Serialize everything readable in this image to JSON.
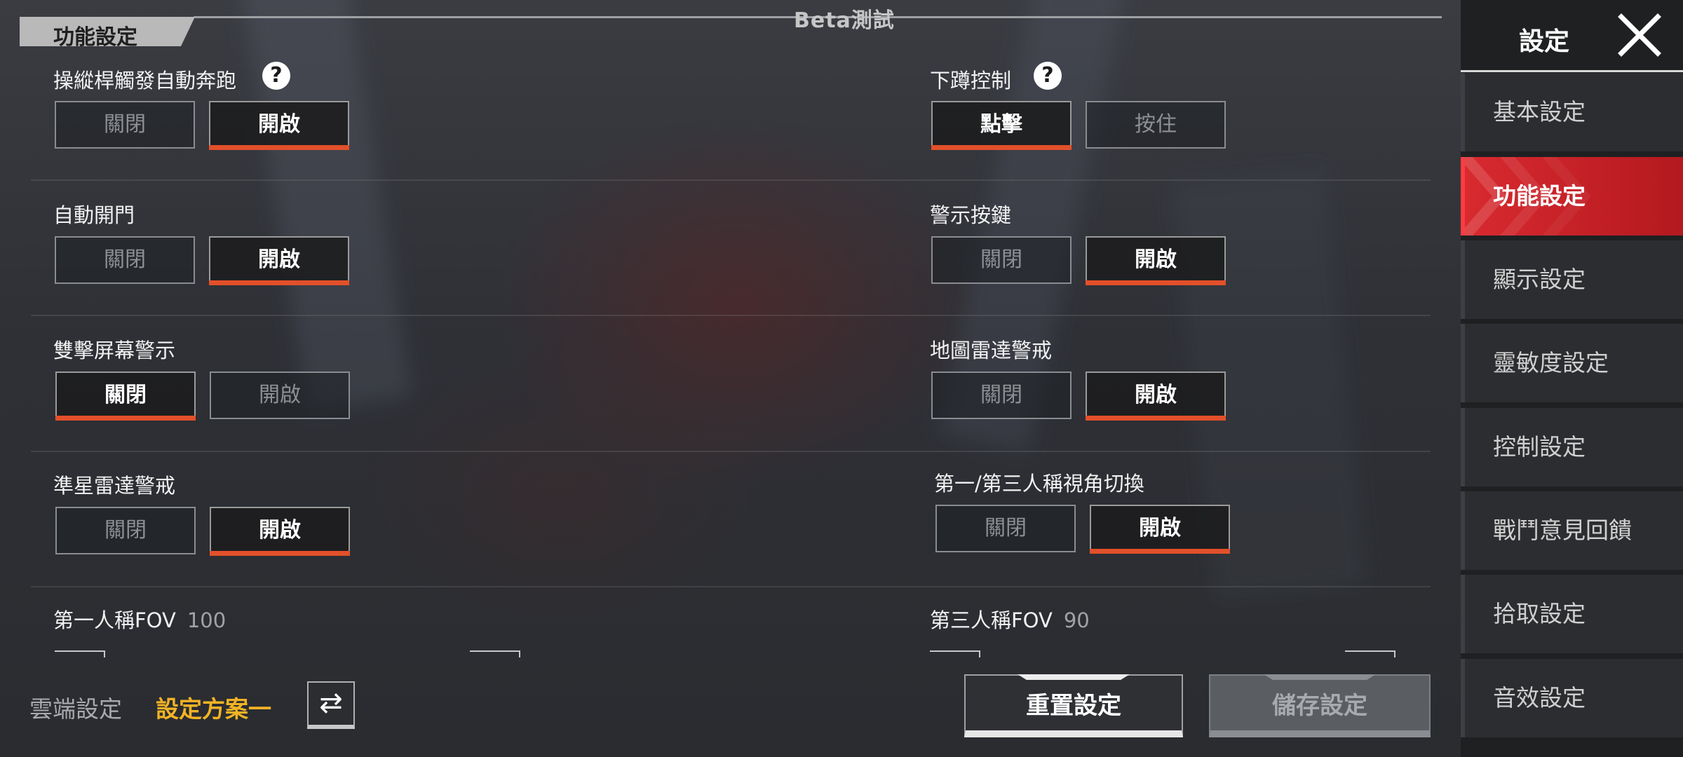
{
  "header": {
    "title": "功能設定",
    "beta_label": "Beta測試"
  },
  "settings": {
    "joystick_autorun": {
      "label": "操縱桿觸發自動奔跑",
      "options": [
        "關閉",
        "開啟"
      ],
      "selected": "開啟",
      "help_icon": "question-circle-icon"
    },
    "crouch_control": {
      "label": "下蹲控制",
      "options": [
        "點擊",
        "按住"
      ],
      "selected": "點擊",
      "help_icon": "question-circle-icon"
    },
    "auto_door": {
      "label": "自動開門",
      "options": [
        "關閉",
        "開啟"
      ],
      "selected": "開啟"
    },
    "alert_button": {
      "label": "警示按鍵",
      "options": [
        "關閉",
        "開啟"
      ],
      "selected": "開啟"
    },
    "double_tap_alert": {
      "label": "雙擊屏幕警示",
      "options": [
        "關閉",
        "開啟"
      ],
      "selected": "關閉"
    },
    "map_radar_alert": {
      "label": "地圖雷達警戒",
      "options": [
        "關閉",
        "開啟"
      ],
      "selected": "開啟"
    },
    "crosshair_radar_alert": {
      "label": "準星雷達警戒",
      "options": [
        "關閉",
        "開啟"
      ],
      "selected": "開啟"
    },
    "perspective_switch": {
      "label": "第一/第三人稱視角切換",
      "options": [
        "關閉",
        "開啟"
      ],
      "selected": "開啟"
    },
    "fov_first": {
      "label": "第一人稱FOV",
      "value": "100"
    },
    "fov_third": {
      "label": "第三人稱FOV",
      "value": "90"
    }
  },
  "footer": {
    "cloud_label": "雲端設定",
    "profile_name": "設定方案一",
    "swap_icon": "swap-arrows-icon",
    "reset_label": "重置設定",
    "save_label": "儲存設定"
  },
  "sidebar": {
    "title": "設定",
    "close_icon": "close-icon",
    "items": [
      {
        "label": "基本設定",
        "active": false
      },
      {
        "label": "功能設定",
        "active": true
      },
      {
        "label": "顯示設定",
        "active": false
      },
      {
        "label": "靈敏度設定",
        "active": false
      },
      {
        "label": "控制設定",
        "active": false
      },
      {
        "label": "戰鬥意見回饋",
        "active": false
      },
      {
        "label": "拾取設定",
        "active": false
      },
      {
        "label": "音效設定",
        "active": false
      }
    ]
  },
  "colors": {
    "accent": "#e2502a",
    "active_nav": "#c82228",
    "profile": "#f2b325"
  }
}
